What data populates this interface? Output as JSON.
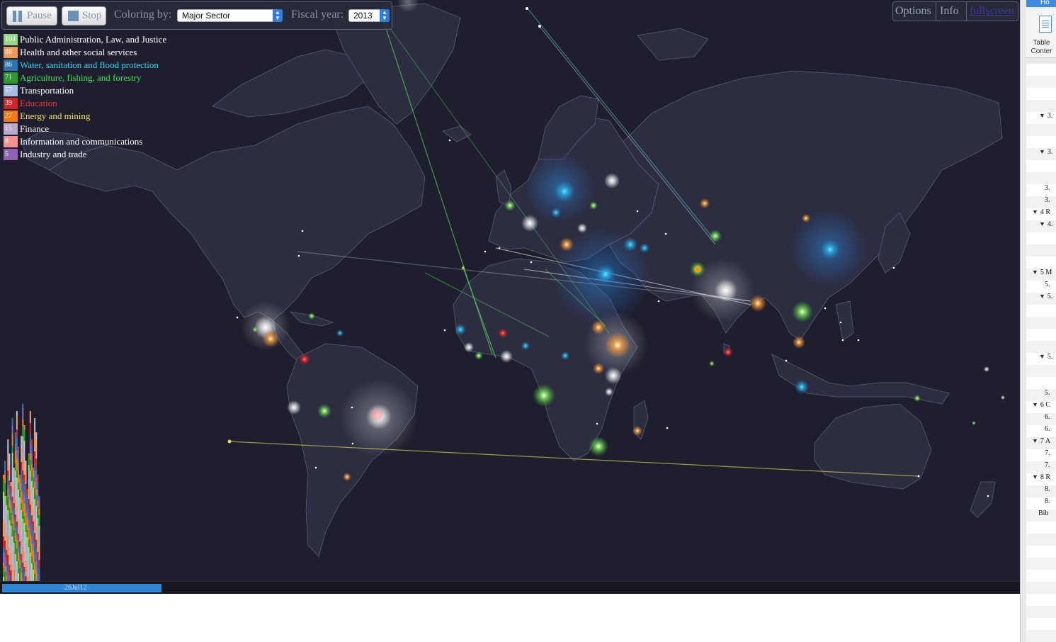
{
  "controls": {
    "pause_label": "Pause",
    "stop_label": "Stop",
    "coloring_label": "Coloring by:",
    "coloring_value": "Major Sector",
    "fiscal_label": "Fiscal year:",
    "fiscal_value": "2013"
  },
  "menu": {
    "options": "Options",
    "info": "Info",
    "fullscreen": "fullscreen"
  },
  "legend": [
    {
      "count": "104",
      "name": "Public Administration, Law, and Justice",
      "color": "#9be28a",
      "text_color": "#ffffff"
    },
    {
      "count": "88",
      "name": "Health and other social services",
      "color": "#f6a35c",
      "text_color": "#ffffff"
    },
    {
      "count": "86",
      "name": "Water, sanitation and flood protection",
      "color": "#2c7bb6",
      "text_color": "#38d6f0"
    },
    {
      "count": "71",
      "name": "Agriculture, fishing, and forestry",
      "color": "#2ca02c",
      "text_color": "#45e05a"
    },
    {
      "count": "57",
      "name": "Transportation",
      "color": "#aec7e8",
      "text_color": "#ffffff"
    },
    {
      "count": "39",
      "name": "Education",
      "color": "#d62728",
      "text_color": "#ff3333"
    },
    {
      "count": "27",
      "name": "Energy and mining",
      "color": "#ff7f0e",
      "text_color": "#f2e64a"
    },
    {
      "count": "15",
      "name": "Finance",
      "color": "#c5b0d5",
      "text_color": "#ffffff"
    },
    {
      "count": "8",
      "name": "Information and communications",
      "color": "#ff9896",
      "text_color": "#ffffff"
    },
    {
      "count": "5",
      "name": "Industry and trade",
      "color": "#9467bd",
      "text_color": "#ffffff"
    }
  ],
  "timeline": {
    "date_label": "26Jul12",
    "progress": 0.156
  },
  "sidepanel": {
    "tab_label": "Ho",
    "toc_label": "Table of Contents",
    "toc_label_line1": "Table",
    "toc_label_line2": "Conter",
    "rows": [
      {
        "text": "3.",
        "tri": "▼"
      },
      {
        "text": "3.",
        "tri": "▼"
      },
      {
        "text": "3.",
        "tri": ""
      },
      {
        "text": "3.",
        "tri": ""
      },
      {
        "text": "4 R",
        "tri": "▼"
      },
      {
        "text": "4.",
        "tri": "▼"
      },
      {
        "text": "5 M",
        "tri": "▼"
      },
      {
        "text": "5.",
        "tri": ""
      },
      {
        "text": "5.",
        "tri": "▼"
      },
      {
        "text": "5.",
        "tri": "▼"
      },
      {
        "text": "5.",
        "tri": ""
      },
      {
        "text": "6 C",
        "tri": "▼"
      },
      {
        "text": "6.",
        "tri": ""
      },
      {
        "text": "6.",
        "tri": ""
      },
      {
        "text": "7 A",
        "tri": "▼"
      },
      {
        "text": "7.",
        "tri": ""
      },
      {
        "text": "7.",
        "tri": ""
      },
      {
        "text": "8 R",
        "tri": "▼"
      },
      {
        "text": "8.",
        "tri": ""
      },
      {
        "text": "8.",
        "tri": ""
      },
      {
        "text": "Bib",
        "tri": ""
      }
    ]
  },
  "map": {
    "background": "#1e1e2e",
    "land_color": "#2c2d40",
    "border_color": "#5a5d78"
  }
}
